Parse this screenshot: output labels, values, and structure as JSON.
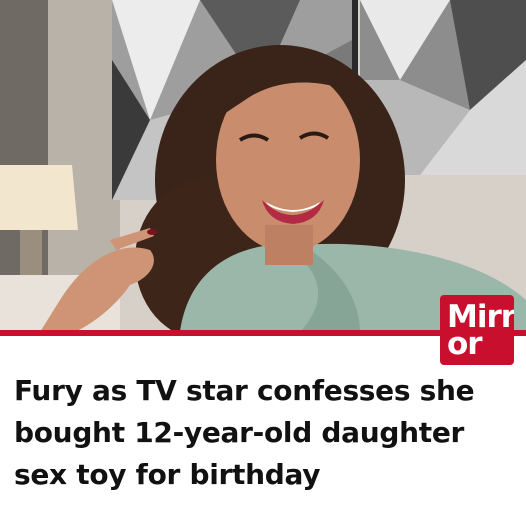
{
  "brand": {
    "logo_line1": "Mirr",
    "logo_line2": "or",
    "accent": "#c8102e"
  },
  "article": {
    "headline": "Fury as TV star confesses she bought 12-year-old daughter sex toy for birthday"
  },
  "image": {
    "icon": "photo-woman-smiling"
  }
}
